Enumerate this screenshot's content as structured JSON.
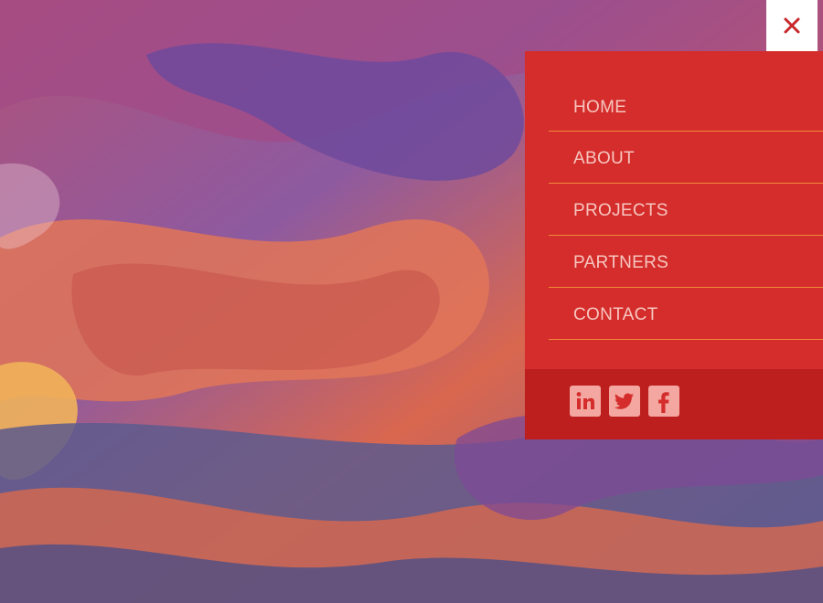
{
  "nav": {
    "close_icon": "close-icon",
    "items": [
      {
        "label": "HOME"
      },
      {
        "label": "ABOUT"
      },
      {
        "label": "PROJECTS"
      },
      {
        "label": "PARTNERS"
      },
      {
        "label": "CONTACT"
      }
    ]
  },
  "social": {
    "icons": [
      "linkedin-icon",
      "twitter-icon",
      "facebook-icon"
    ]
  },
  "colors": {
    "panel": "#d42d2b",
    "social_bar": "#bd1e1e",
    "menu_text": "#f7c6c0",
    "divider": "#f08a3a",
    "close_bg": "#ffffff",
    "close_x": "#c8282b"
  }
}
